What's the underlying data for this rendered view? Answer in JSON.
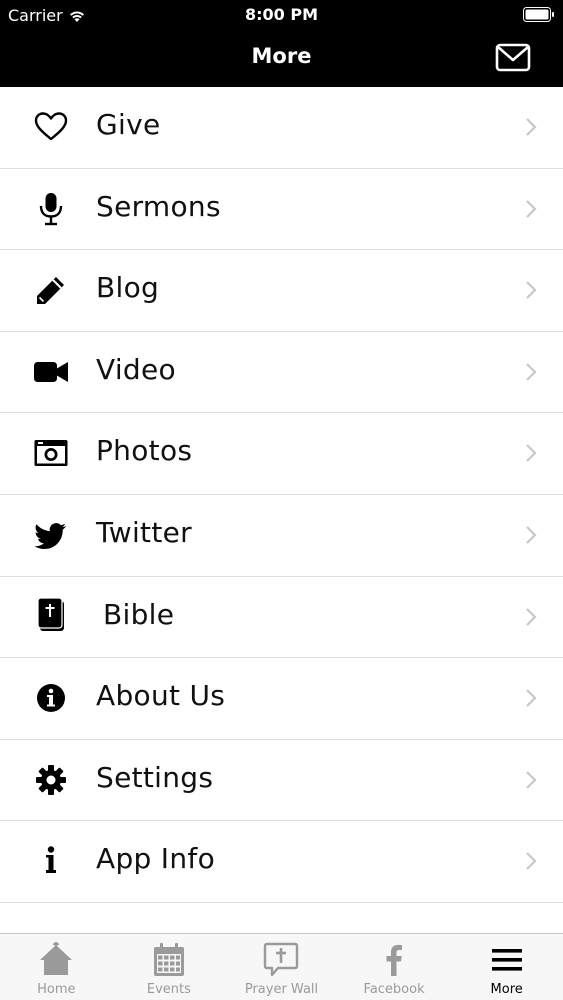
{
  "status": {
    "carrier": "Carrier",
    "time": "8:00 PM"
  },
  "nav": {
    "title": "More",
    "mail_icon": "envelope-icon"
  },
  "menu": [
    {
      "label": "Give",
      "icon": "heart-icon"
    },
    {
      "label": "Sermons",
      "icon": "microphone-icon"
    },
    {
      "label": "Blog",
      "icon": "pencil-icon"
    },
    {
      "label": "Video",
      "icon": "video-camera-icon"
    },
    {
      "label": "Photos",
      "icon": "camera-icon"
    },
    {
      "label": "Twitter",
      "icon": "twitter-bird-icon"
    },
    {
      "label": "Bible",
      "icon": "bible-icon"
    },
    {
      "label": "About Us",
      "icon": "info-circle-icon"
    },
    {
      "label": "Settings",
      "icon": "gear-icon"
    },
    {
      "label": "App Info",
      "icon": "info-icon"
    }
  ],
  "tabs": [
    {
      "label": "Home",
      "icon": "house-icon",
      "active": false
    },
    {
      "label": "Events",
      "icon": "calendar-icon",
      "active": false
    },
    {
      "label": "Prayer Wall",
      "icon": "prayer-bubble-icon",
      "active": false
    },
    {
      "label": "Facebook",
      "icon": "facebook-icon",
      "active": false
    },
    {
      "label": "More",
      "icon": "hamburger-icon",
      "active": true
    }
  ],
  "colors": {
    "bar_bg": "#000000",
    "tab_inactive": "#9a9a9a",
    "tab_active": "#000000",
    "chevron": "#c7c7cc"
  }
}
